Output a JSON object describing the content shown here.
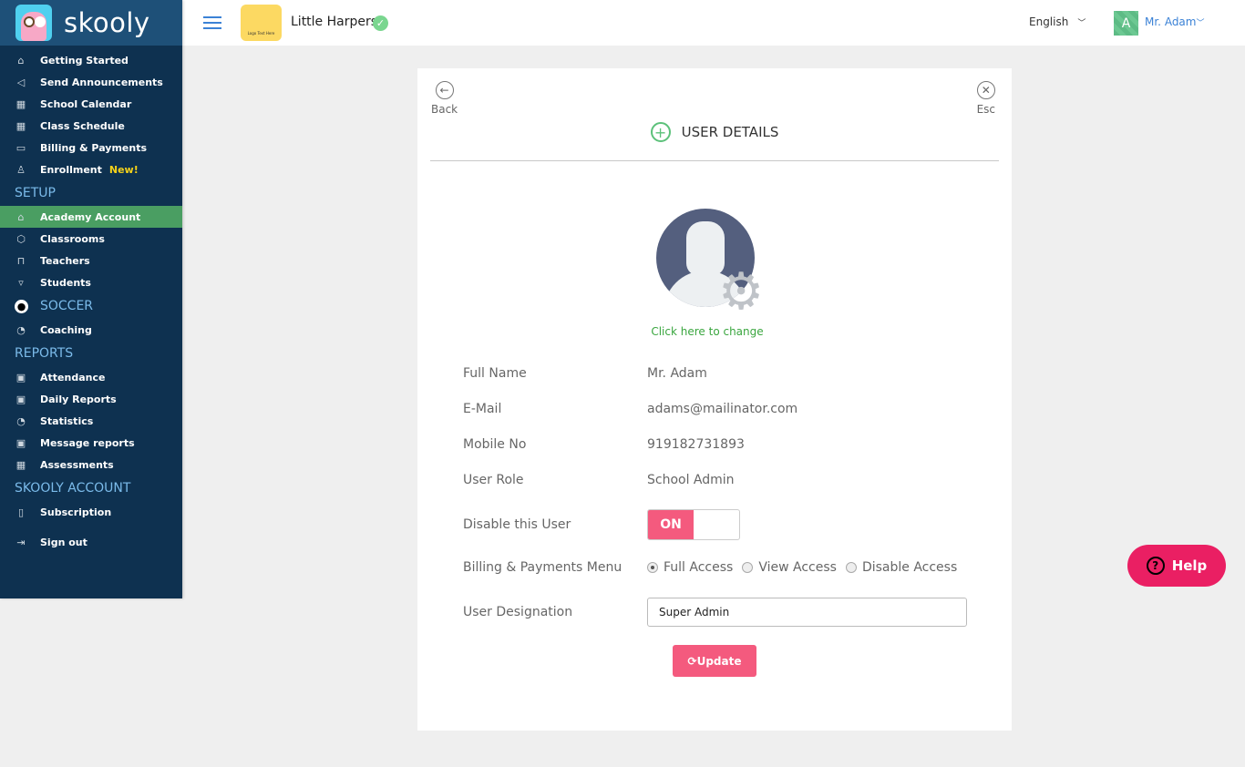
{
  "brand": {
    "name": "skooly"
  },
  "header": {
    "school_name": "Little Harpers",
    "school_logo_text": "Logo Text Here",
    "language": "English",
    "user_initial": "A",
    "user_name": "Mr. Adam"
  },
  "sidebar": {
    "main": [
      {
        "label": "Getting Started",
        "icon": "home-icon"
      },
      {
        "label": "Send Announcements",
        "icon": "megaphone-icon"
      },
      {
        "label": "School Calendar",
        "icon": "calendar-icon"
      },
      {
        "label": "Class Schedule",
        "icon": "calendar-icon"
      },
      {
        "label": "Billing & Payments",
        "icon": "credit-card-icon"
      },
      {
        "label": "Enrollment",
        "icon": "add-user-icon",
        "badge": "New!"
      }
    ],
    "setup_title": "SETUP",
    "setup": [
      {
        "label": "Academy Account",
        "icon": "building-icon",
        "active": true
      },
      {
        "label": "Classrooms",
        "icon": "box-icon"
      },
      {
        "label": "Teachers",
        "icon": "desk-icon"
      },
      {
        "label": "Students",
        "icon": "tie-icon"
      }
    ],
    "soccer_title": "SOCCER",
    "soccer": [
      {
        "label": "Coaching",
        "icon": "whistle-icon"
      }
    ],
    "reports_title": "REPORTS",
    "reports": [
      {
        "label": "Attendance",
        "icon": "calendar-day-icon"
      },
      {
        "label": "Daily Reports",
        "icon": "calendar-day-icon"
      },
      {
        "label": "Statistics",
        "icon": "pie-chart-icon"
      },
      {
        "label": "Message reports",
        "icon": "calendar-day-icon"
      },
      {
        "label": "Assessments",
        "icon": "calendar-icon"
      }
    ],
    "account_title": "SKOOLY ACCOUNT",
    "account": [
      {
        "label": "Subscription",
        "icon": "bookmark-icon"
      }
    ],
    "signout": "Sign out"
  },
  "card": {
    "back": "Back",
    "esc": "Esc",
    "title": "USER DETAILS",
    "change_photo": "Click here to change",
    "fields": {
      "full_name": {
        "label": "Full Name",
        "value": "Mr. Adam"
      },
      "email": {
        "label": "E-Mail",
        "value": "adams@mailinator.com"
      },
      "mobile": {
        "label": "Mobile No",
        "value": "919182731893"
      },
      "role": {
        "label": "User Role",
        "value": "School Admin"
      },
      "disable": {
        "label": "Disable this User",
        "toggle": "ON"
      },
      "billing": {
        "label": "Billing & Payments Menu",
        "options": [
          "Full Access",
          "View Access",
          "Disable Access"
        ],
        "selected": "Full Access"
      },
      "designation": {
        "label": "User Designation",
        "value": "Super Admin"
      }
    },
    "update": "Update"
  },
  "help": "Help",
  "colors": {
    "sidebar": "#0e3150",
    "brand_bar": "#1e5078",
    "active": "#4a9e62",
    "accent_pink": "#f45a7e",
    "help": "#ea1f63",
    "link_green": "#3aa63f"
  }
}
